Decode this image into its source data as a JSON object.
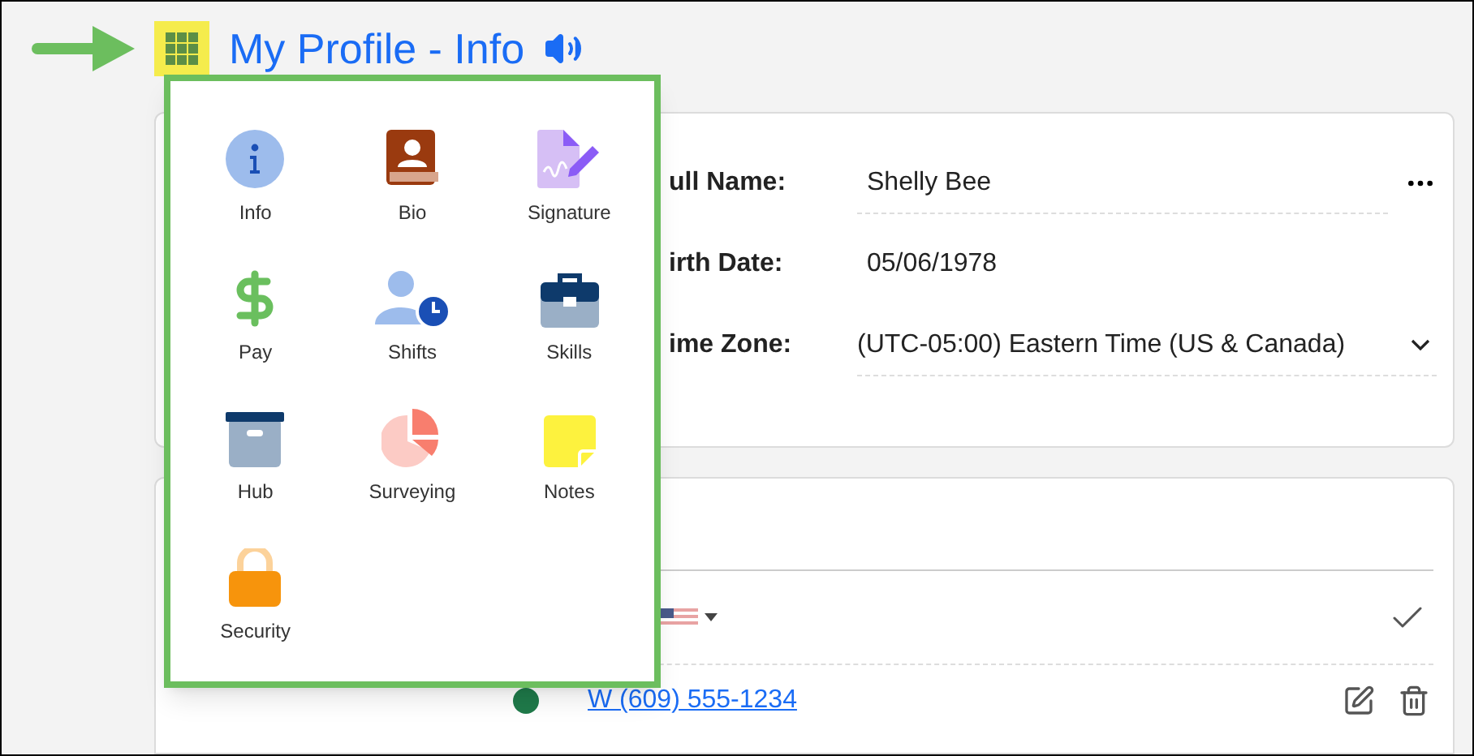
{
  "header": {
    "title": "My Profile - Info"
  },
  "app_menu": {
    "items": [
      {
        "label": "Info",
        "kind": "info"
      },
      {
        "label": "Bio",
        "kind": "bio"
      },
      {
        "label": "Signature",
        "kind": "signature"
      },
      {
        "label": "Pay",
        "kind": "pay"
      },
      {
        "label": "Shifts",
        "kind": "shifts"
      },
      {
        "label": "Skills",
        "kind": "skills"
      },
      {
        "label": "Hub",
        "kind": "hub"
      },
      {
        "label": "Surveying",
        "kind": "surveying"
      },
      {
        "label": "Notes",
        "kind": "notes"
      },
      {
        "label": "Security",
        "kind": "security"
      }
    ]
  },
  "profile_fields": [
    {
      "label": "ull Name:",
      "value": "Shelly Bee",
      "kind": "text"
    },
    {
      "label": "irth Date:",
      "value": "05/06/1978",
      "kind": "plain"
    },
    {
      "label": "ime Zone:",
      "value": "(UTC-05:00) Eastern Time (US & Canada)",
      "kind": "select"
    }
  ],
  "phones": {
    "entries": [
      {
        "number": "W (609) 555-1234"
      }
    ]
  }
}
